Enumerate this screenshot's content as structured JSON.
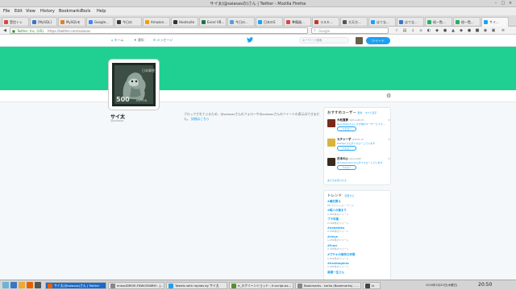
{
  "window": {
    "title": "サイ太(@saiasasの)さん | Twitter - Mozilla Firefox"
  },
  "menu": [
    "File",
    "Edit",
    "View",
    "History",
    "Bookmarks",
    "Tools",
    "Help"
  ],
  "tabs": [
    {
      "label": "受信トレ",
      "color": "#d44"
    },
    {
      "label": "[MySQL]",
      "color": "#3a76c4"
    },
    {
      "label": "MySQLを",
      "color": "#e67e22"
    },
    {
      "label": "Google...",
      "color": "#4285f4"
    },
    {
      "label": "今日の",
      "color": "#3a3a3a"
    },
    {
      "label": "Amazon...",
      "color": "#f39c12"
    },
    {
      "label": "Hootsuite",
      "color": "#333"
    },
    {
      "label": "Excel VB...",
      "color": "#217346"
    },
    {
      "label": "今日の...",
      "color": "#5b9bd5"
    },
    {
      "label": "日本のS",
      "color": "#1da1f2"
    },
    {
      "label": "準備器...",
      "color": "#d44"
    },
    {
      "label": "ラスキ...",
      "color": "#c0392b"
    },
    {
      "label": "大天方...",
      "color": "#555"
    },
    {
      "label": "はてな...",
      "color": "#1da1f2"
    },
    {
      "label": "はてな...",
      "color": "#3a76c4"
    },
    {
      "label": "紐一覧...",
      "color": "#27ae60"
    },
    {
      "label": "紐一覧...",
      "color": "#27ae60"
    },
    {
      "label": "サイ...",
      "color": "#1da1f2",
      "active": true
    }
  ],
  "nav": {
    "site_label": "Twitter, Inc. (US)",
    "url": "https://twitter.com/saiasas",
    "search_placeholder": "Google"
  },
  "twitter_nav": {
    "home": "ホーム",
    "notifications": "通知",
    "messages": "メッセージ",
    "search_placeholder": "キーワード検索",
    "tweet_button": "ツイート"
  },
  "profile": {
    "name": "サイ太",
    "handle": "@saiasas",
    "stamp_value": "500",
    "stamp_text": "NIPPON",
    "stamp_top_text": "日本郵便"
  },
  "blocked_message": {
    "text": "ブロックされているため、@saiasasさんのフォローや@saiasasさんのツイートの表示はできません。",
    "link": "詳細はこちら"
  },
  "who_to_follow": {
    "title": "おすすめユーザー",
    "refresh": "更新",
    "view_all": "すべて表示",
    "follow_label": "フォロー",
    "users": [
      {
        "name": "大松寛夢",
        "handle": "@MuraMizH...",
        "desc": "NeonTubeさんとその他のユーザーにフォ…",
        "color": "#7a2a1c"
      },
      {
        "name": "カチャー子",
        "handle": "@fetiC.ck",
        "desc": "Kristiyuさんがフォローしています",
        "color": "#d8b43c"
      },
      {
        "name": "日本の心",
        "handle": "@soulofJP",
        "desc": "あさ@wisdomさんがフォローしています",
        "color": "#3a2b1e"
      }
    ],
    "footer": "友だちを見つける"
  },
  "trends": {
    "title": "トレンド",
    "change": "変更する",
    "items": [
      {
        "name": "#磯村勇斗",
        "count": "PR ワイドショー ページ",
        "promoted": true
      },
      {
        "name": "#暇人の集まり",
        "count": "1,264件のツイート"
      },
      {
        "name": "プラ卒業",
        "count": "2,508件のツイート"
      },
      {
        "name": "#nokotaku",
        "count": "2,346件のツイート"
      },
      {
        "name": "#rinye",
        "count": "1,250件のツイート"
      },
      {
        "name": "#Sunc",
        "count": "2,345件のツイート"
      },
      {
        "name": "#マサキの愉快な仲間",
        "count": "1,954件のツイート"
      },
      {
        "name": "#hashtaginss",
        "count": "1,283件のツイート"
      },
      {
        "name": "高橋一生さん",
        "count": ""
      }
    ]
  },
  "taskbar": {
    "tasks": [
      {
        "label": "サイ太(@saiasas)さん | Twitter",
        "active": true,
        "color": "#e66000"
      },
      {
        "label": "entaxiDRIVE-F8W03S6RM - [...",
        "color": "#888"
      },
      {
        "label": "Tweets with replies by サイ太",
        "color": "#1da1f2"
      },
      {
        "label": "e_スクリーンショット - fr-script-ex...",
        "color": "#5a8f29"
      },
      {
        "label": "Bookmarks - Ixelio (Bookmarks) - ...",
        "color": "#888"
      },
      {
        "label": "Ix",
        "color": "#444"
      }
    ],
    "date": "2016年5月20日(木曜日)",
    "clock": "20:50"
  }
}
